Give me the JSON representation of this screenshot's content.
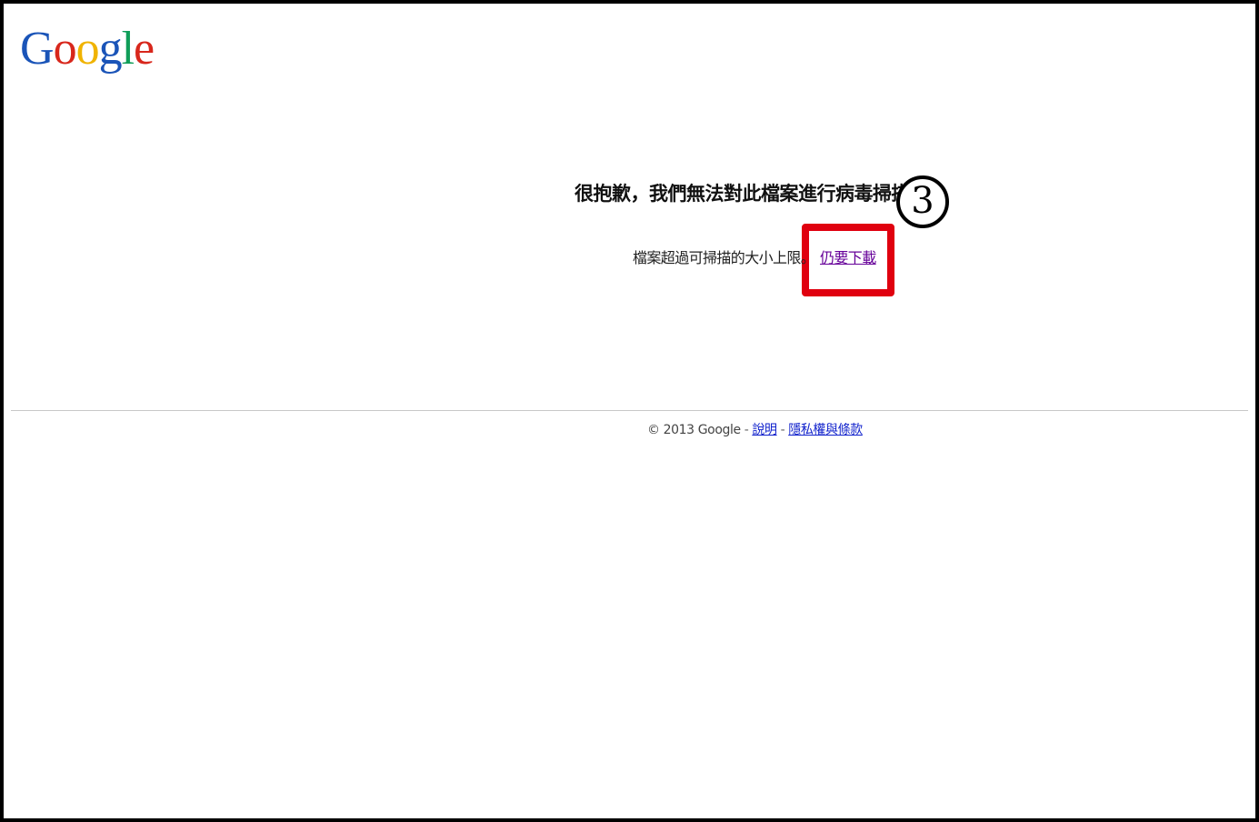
{
  "logo": {
    "text": "Google",
    "letters": [
      "G",
      "o",
      "o",
      "g",
      "l",
      "e"
    ],
    "colors": [
      "#1a54b8",
      "#d8271c",
      "#f0b300",
      "#1a54b8",
      "#0f9d58",
      "#d8271c"
    ]
  },
  "message": {
    "headline": "很抱歉，我們無法對此檔案進行病毒掃描。",
    "detail": "檔案超過可掃描的大小上限。",
    "download_link": "仍要下載"
  },
  "annotation": {
    "step_number": "3",
    "highlight_color": "#e0000f"
  },
  "footer": {
    "copyright": "© 2013 Google",
    "separator": "-",
    "links": [
      "說明",
      "隱私權與條款"
    ],
    "link_color": "#1122cc"
  }
}
